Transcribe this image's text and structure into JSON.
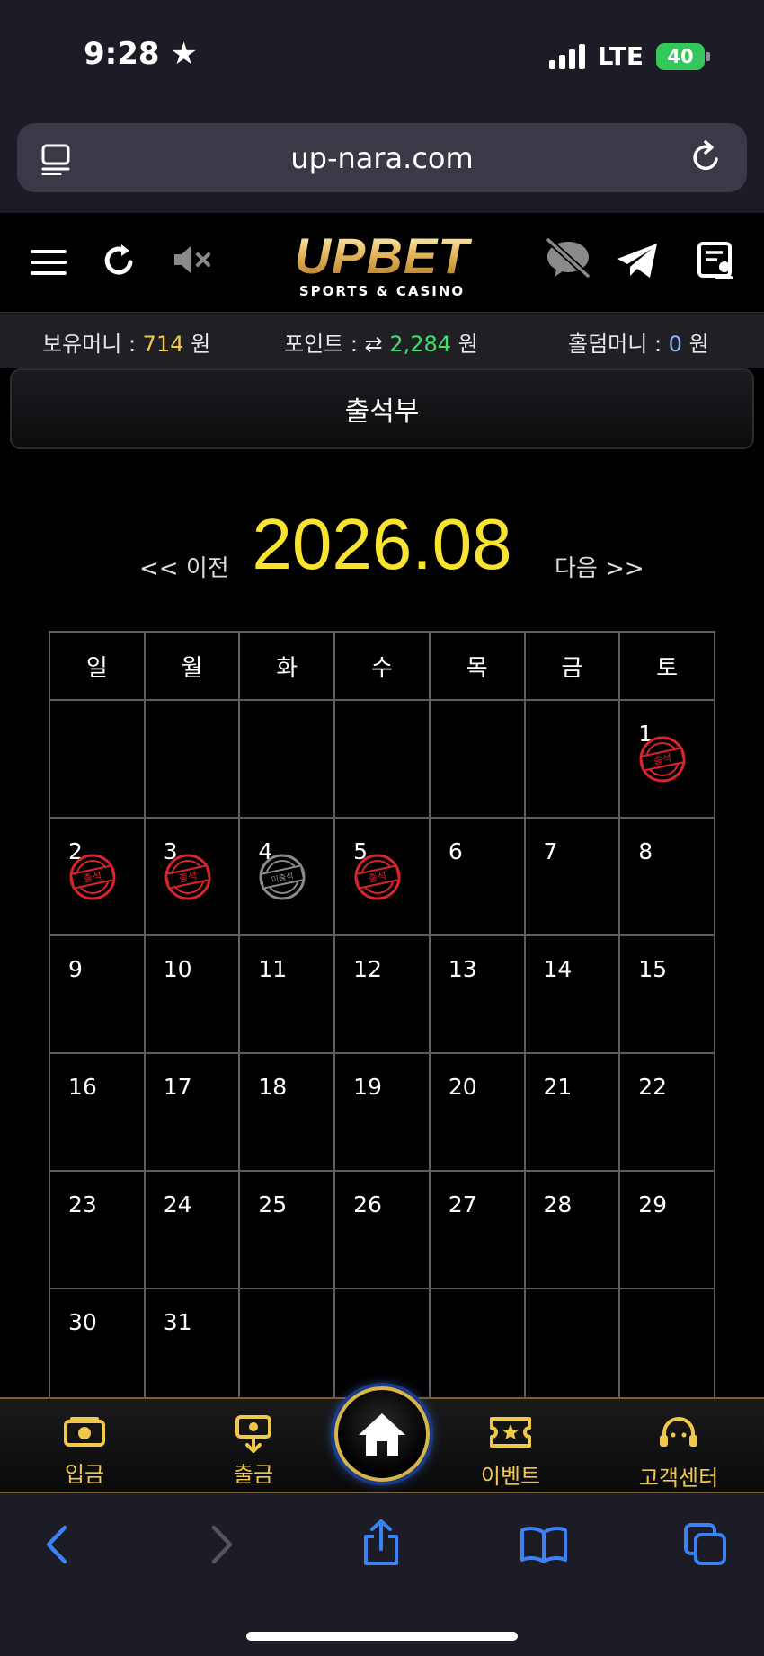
{
  "status_bar": {
    "time": "9:28",
    "network": "LTE",
    "battery": "40"
  },
  "browser": {
    "url": "up-nara.com"
  },
  "site": {
    "logo_main": "UPBET",
    "logo_sub": "SPORTS & CASINO"
  },
  "balances": {
    "money_label": "보유머니 : ",
    "money_value": "714",
    "money_unit": " 원",
    "point_label": "포인트 : ",
    "point_value": "2,284",
    "point_unit": " 원",
    "holdem_label": "홀덤머니 : ",
    "holdem_value": "0",
    "holdem_unit": " 원"
  },
  "page_title": "출석부",
  "calendar": {
    "prev_label": "<< 이전",
    "month": "2026.08",
    "next_label": "다음 >>",
    "weekdays": [
      "일",
      "월",
      "화",
      "수",
      "목",
      "금",
      "토"
    ],
    "stamp_attended": "출석",
    "stamp_missed": "미출석",
    "weeks": [
      [
        {
          "d": ""
        },
        {
          "d": ""
        },
        {
          "d": ""
        },
        {
          "d": ""
        },
        {
          "d": ""
        },
        {
          "d": ""
        },
        {
          "d": "1",
          "s": "attended"
        }
      ],
      [
        {
          "d": "2",
          "s": "attended"
        },
        {
          "d": "3",
          "s": "attended"
        },
        {
          "d": "4",
          "s": "missed"
        },
        {
          "d": "5",
          "s": "attended"
        },
        {
          "d": "6"
        },
        {
          "d": "7"
        },
        {
          "d": "8"
        }
      ],
      [
        {
          "d": "9"
        },
        {
          "d": "10"
        },
        {
          "d": "11"
        },
        {
          "d": "12"
        },
        {
          "d": "13"
        },
        {
          "d": "14"
        },
        {
          "d": "15"
        }
      ],
      [
        {
          "d": "16"
        },
        {
          "d": "17"
        },
        {
          "d": "18"
        },
        {
          "d": "19"
        },
        {
          "d": "20"
        },
        {
          "d": "21"
        },
        {
          "d": "22"
        }
      ],
      [
        {
          "d": "23"
        },
        {
          "d": "24"
        },
        {
          "d": "25"
        },
        {
          "d": "26"
        },
        {
          "d": "27"
        },
        {
          "d": "28"
        },
        {
          "d": "29"
        }
      ],
      [
        {
          "d": "30"
        },
        {
          "d": "31"
        },
        {
          "d": ""
        },
        {
          "d": ""
        },
        {
          "d": ""
        },
        {
          "d": ""
        },
        {
          "d": ""
        }
      ]
    ]
  },
  "app_nav": {
    "deposit": "입금",
    "withdraw": "출금",
    "event": "이벤트",
    "support": "고객센터"
  },
  "colors": {
    "accent_gold": "#f0c84a",
    "month_yellow": "#f7e330",
    "point_green": "#3ee06a",
    "stamp_red": "#d8242c",
    "stamp_gray": "#8a8a8a",
    "ios_blue": "#3b82f6"
  }
}
